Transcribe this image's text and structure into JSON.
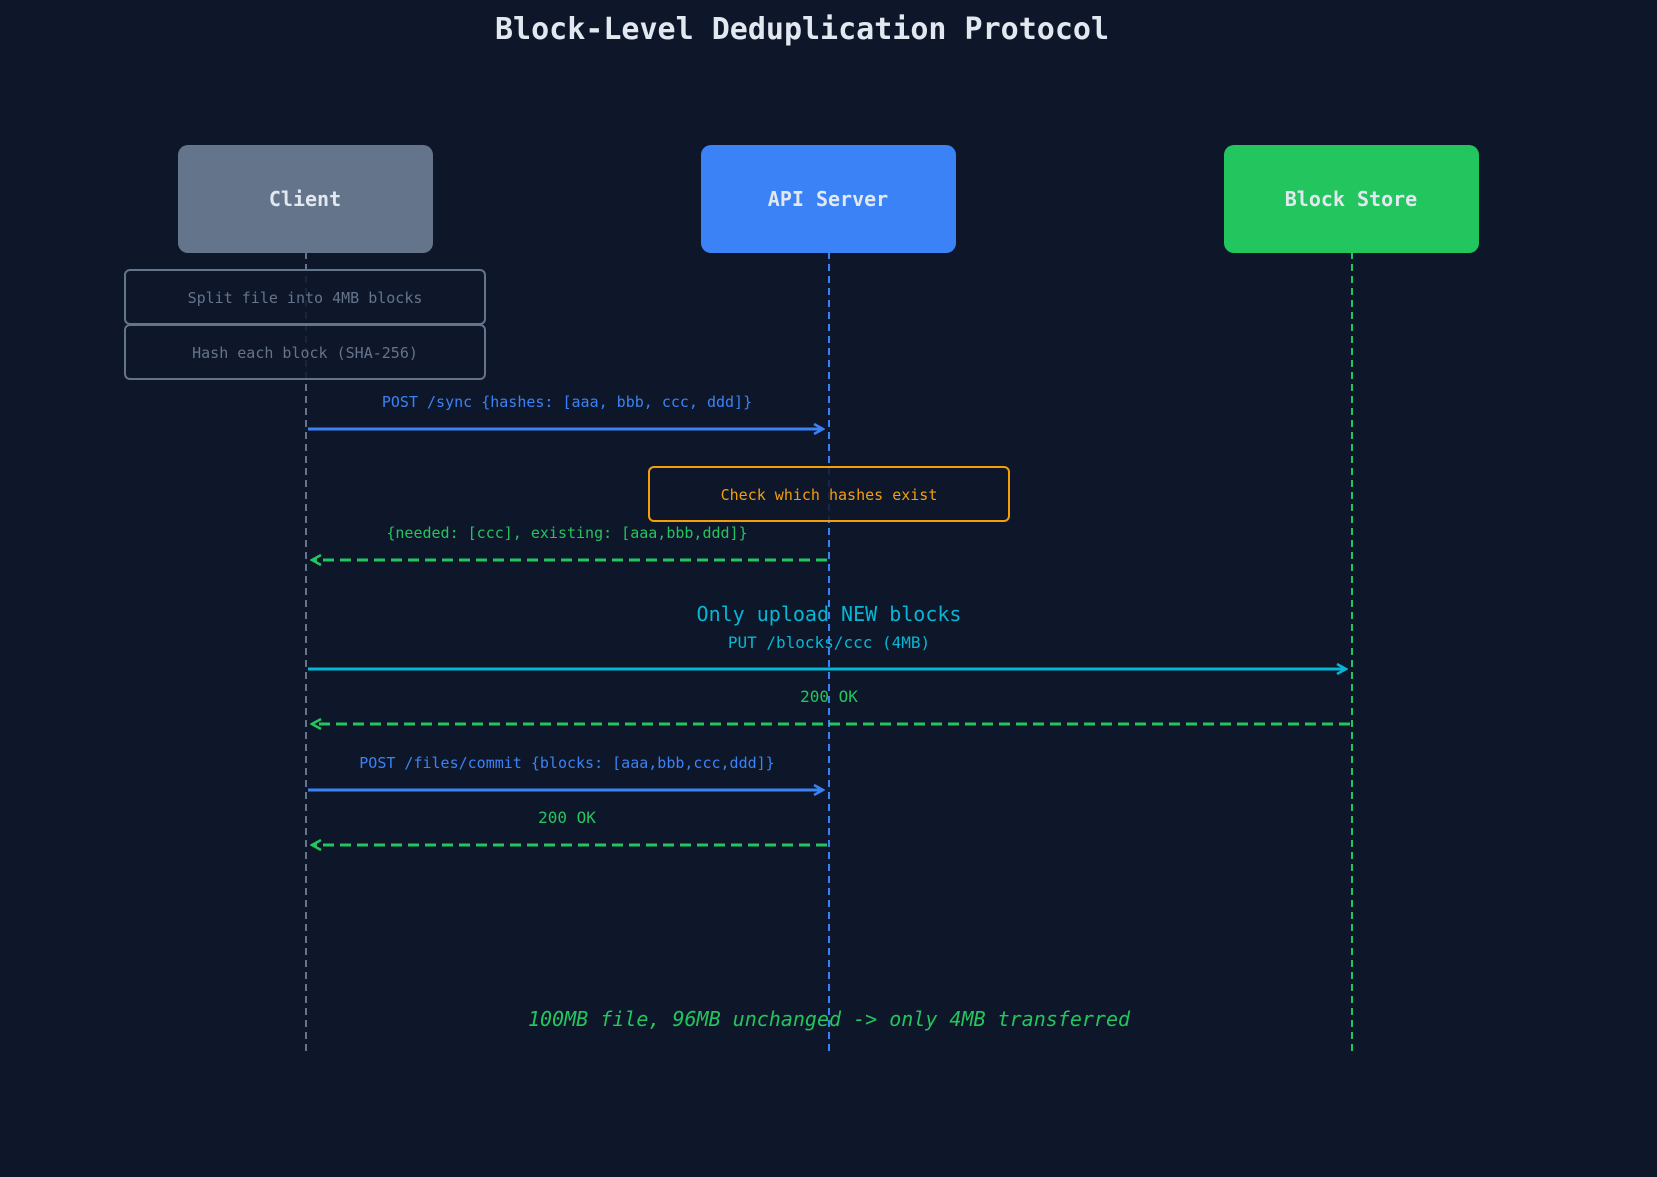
{
  "title": "Block-Level Deduplication Protocol",
  "colors": {
    "background": "#0e172a",
    "client": "#64748b",
    "server": "#3b82f6",
    "store": "#22c55e",
    "accent_orange": "#f59e0b",
    "accent_cyan": "#06b6d4",
    "response_green": "#22c55e",
    "note_gray": "#64748b",
    "text_light": "#e2e8f0"
  },
  "participants": [
    {
      "id": "client",
      "label": "Client",
      "color": "#64748b"
    },
    {
      "id": "server",
      "label": "API Server",
      "color": "#3b82f6"
    },
    {
      "id": "store",
      "label": "Block Store",
      "color": "#22c55e"
    }
  ],
  "notes": [
    {
      "on": "client",
      "text": "Split file into 4MB blocks",
      "color": "#64748b"
    },
    {
      "on": "client",
      "text": "Hash each block (SHA-256)",
      "color": "#64748b"
    },
    {
      "on": "server",
      "text": "Check which hashes exist",
      "color": "#f59e0b"
    }
  ],
  "messages": [
    {
      "from": "client",
      "to": "server",
      "text": "POST /sync {hashes: [aaa, bbb, ccc, ddd]}",
      "style": "solid",
      "color": "#3b82f6"
    },
    {
      "from": "server",
      "to": "client",
      "text": "{needed: [ccc], existing: [aaa,bbb,ddd]}",
      "style": "dashed",
      "color": "#22c55e"
    },
    {
      "from": "client",
      "to": "store",
      "text": "PUT /blocks/ccc (4MB)",
      "style": "solid",
      "color": "#06b6d4"
    },
    {
      "from": "store",
      "to": "client",
      "text": "200 OK",
      "style": "dashed",
      "color": "#22c55e"
    },
    {
      "from": "client",
      "to": "server",
      "text": "POST /files/commit {blocks: [aaa,bbb,ccc,ddd]}",
      "style": "solid",
      "color": "#3b82f6"
    },
    {
      "from": "server",
      "to": "client",
      "text": "200 OK",
      "style": "dashed",
      "color": "#22c55e"
    }
  ],
  "section_label": "Only upload NEW blocks",
  "footer": "100MB file, 96MB unchanged -> only 4MB transferred"
}
